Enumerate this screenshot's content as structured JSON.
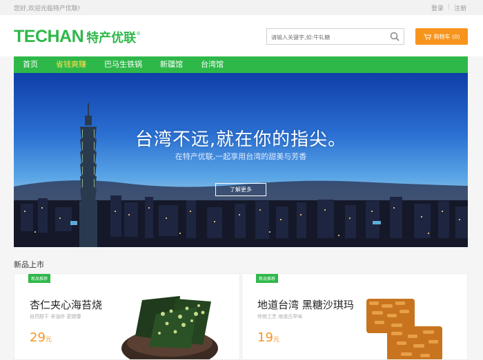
{
  "topbar": {
    "welcome": "您好,欢迎光临特产优联!",
    "login": "登录",
    "register": "注册"
  },
  "header": {
    "brand": "TECHAN",
    "brand_cn": "特产优联",
    "search_placeholder": "请输入关键字,如:牛轧糖",
    "cart_label": "购物车 (0)"
  },
  "nav": {
    "items": [
      "首页",
      "省钱爽赚",
      "巴马生铁锅",
      "新疆馆",
      "台湾馆"
    ]
  },
  "banner": {
    "headline": "台湾不远,就在你的指尖。",
    "sub": "在特产优联,一起享用台湾的甜美与芳香",
    "button": "了解更多"
  },
  "section": {
    "title": "新品上市"
  },
  "products": [
    {
      "tag": "新品推荐",
      "name": "杏仁夹心海苔烧",
      "desc": "自然醇干 非油炸 更健康",
      "price": "29",
      "unit": "元"
    },
    {
      "tag": "新品推荐",
      "name": "地道台湾 黑糖沙琪玛",
      "desc": "传统工艺 地道古早味",
      "price": "19",
      "unit": "元"
    }
  ],
  "colors": {
    "accent_green": "#2fb84a",
    "accent_orange": "#f7941d",
    "nav_active": "#ffe14a"
  }
}
